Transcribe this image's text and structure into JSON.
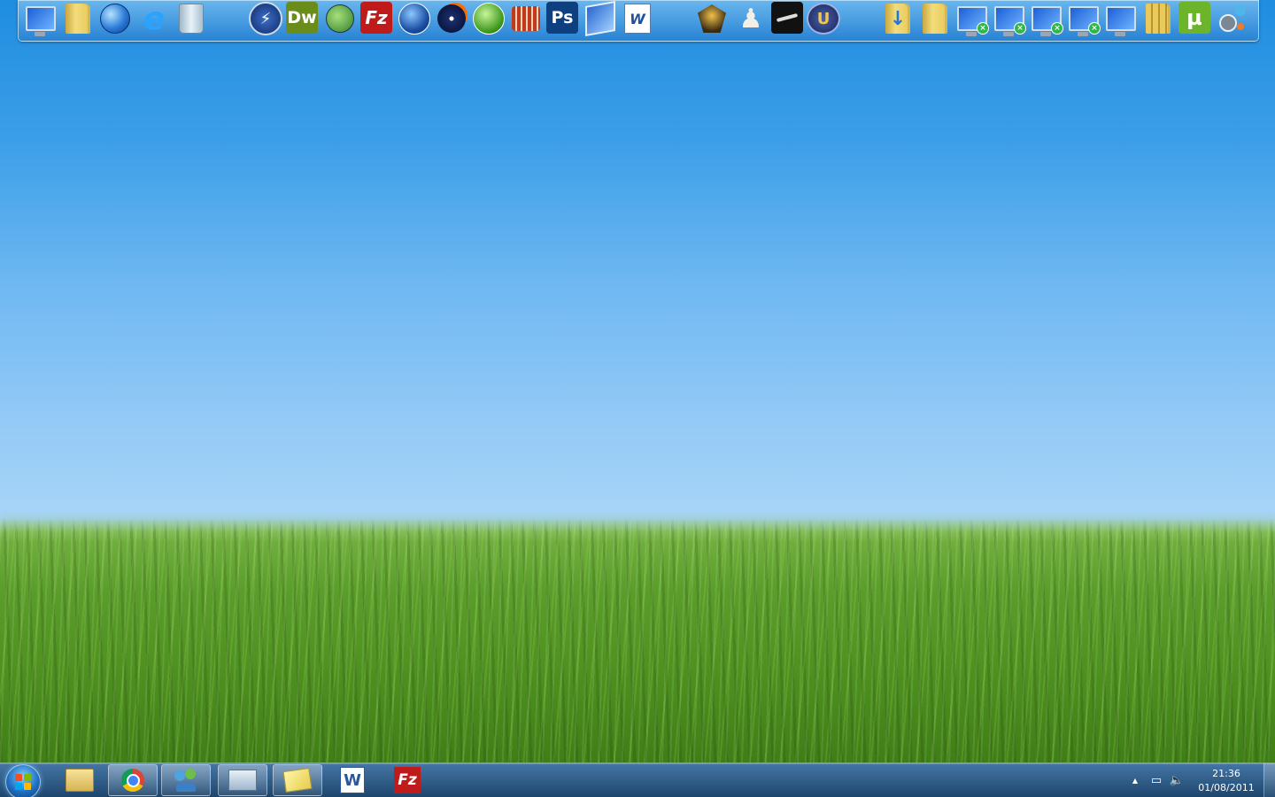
{
  "dock": {
    "icons": [
      {
        "name": "computer-icon"
      },
      {
        "name": "user-folder-icon"
      },
      {
        "name": "network-globe-icon"
      },
      {
        "name": "internet-explorer-icon",
        "glyph": "e"
      },
      {
        "name": "recycle-bin-icon"
      },
      {
        "name": "lightning-app-icon",
        "glyph": "⚡"
      },
      {
        "name": "dreamweaver-icon",
        "glyph": "Dw"
      },
      {
        "name": "edit-globe-tool-icon"
      },
      {
        "name": "filezilla-icon",
        "glyph": "Fz"
      },
      {
        "name": "google-earth-icon"
      },
      {
        "name": "nero-burn-icon"
      },
      {
        "name": "windows-live-icon"
      },
      {
        "name": "coliseum-app-icon"
      },
      {
        "name": "photoshop-icon",
        "glyph": "Ps"
      },
      {
        "name": "network-transfer-icon"
      },
      {
        "name": "word-document-icon",
        "glyph": "W"
      },
      {
        "name": "game-warrior-icon"
      },
      {
        "name": "chess-pawn-icon",
        "glyph": "♟"
      },
      {
        "name": "steam-icon"
      },
      {
        "name": "unreal-tournament-icon",
        "glyph": "U"
      },
      {
        "name": "downloads-folder-icon",
        "glyph": "↓"
      },
      {
        "name": "shared-folder-icon"
      },
      {
        "name": "network-computer-1-icon"
      },
      {
        "name": "network-computer-2-icon"
      },
      {
        "name": "network-computer-3-icon"
      },
      {
        "name": "network-computer-4-icon"
      },
      {
        "name": "computer-display-icon"
      },
      {
        "name": "archive-folder-icon"
      },
      {
        "name": "utorrent-icon",
        "glyph": "µ"
      },
      {
        "name": "settings-bubbles-icon"
      }
    ]
  },
  "taskbar": {
    "items": [
      {
        "name": "explorer-folder-icon"
      },
      {
        "name": "chrome-icon"
      },
      {
        "name": "messenger-icon"
      },
      {
        "name": "email-window-icon"
      },
      {
        "name": "sticky-folder-icon"
      },
      {
        "name": "word-icon",
        "glyph": "W"
      },
      {
        "name": "filezilla-taskbar-icon",
        "glyph": "Fz"
      }
    ],
    "tray": {
      "arrow": "▲",
      "network": "▭",
      "volume": "🔈"
    },
    "clock": {
      "time": "21:36",
      "date": "01/08/2011"
    }
  },
  "colors": {
    "dreamweaver": "#6a8c1a",
    "filezilla": "#bf1b1b",
    "photoshop": "#0e3f7f",
    "steam": "#111111",
    "utorrent": "#6cb52b"
  }
}
